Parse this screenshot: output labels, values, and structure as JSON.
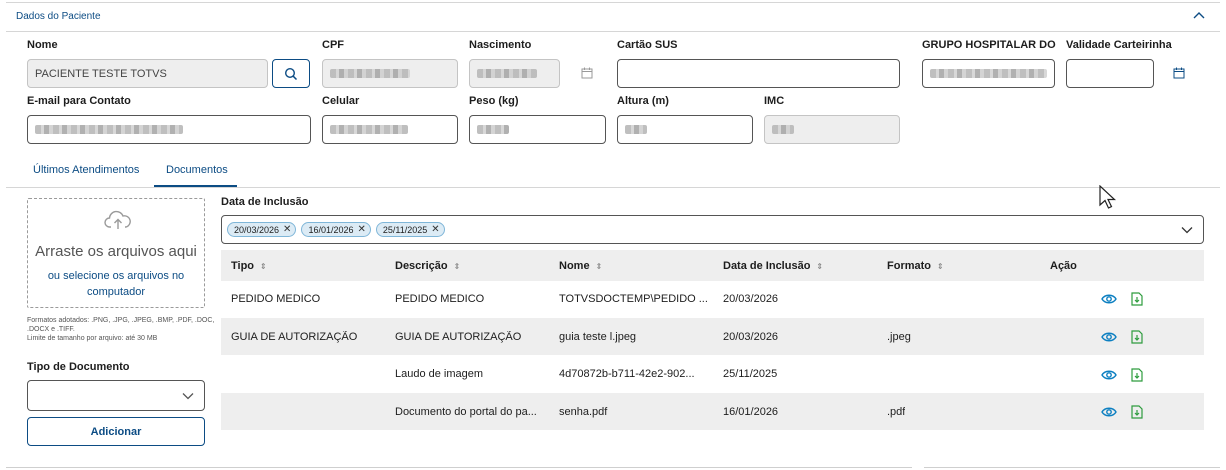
{
  "panel": {
    "title": "Dados do Paciente",
    "collapse_icon": "chevron-up-icon"
  },
  "fields": {
    "nome": {
      "label": "Nome",
      "value": "PACIENTE TESTE TOTVS"
    },
    "cpf": {
      "label": "CPF"
    },
    "nascimento": {
      "label": "Nascimento"
    },
    "cartao_sus": {
      "label": "Cartão SUS",
      "value": ""
    },
    "grupo": {
      "label": "GRUPO HOSPITALAR DO"
    },
    "validade": {
      "label": "Validade Carteirinha",
      "value": ""
    },
    "email": {
      "label": "E-mail para Contato"
    },
    "celular": {
      "label": "Celular"
    },
    "peso": {
      "label": "Peso (kg)"
    },
    "altura": {
      "label": "Altura (m)"
    },
    "imc": {
      "label": "IMC"
    }
  },
  "tabs": [
    {
      "label": "Últimos Atendimentos"
    },
    {
      "label": "Documentos"
    }
  ],
  "upload": {
    "title": "Arraste os arquivos aqui",
    "link": "ou selecione os arquivos no computador",
    "formats": "Formatos adotados: .PNG, .JPG, .JPEG, .BMP, .PDF, .DOC, .DOCX e .TIFF.",
    "limit": "Limite de tamanho por arquivo: até 30 MB"
  },
  "tipo_documento": {
    "label": "Tipo de Documento",
    "value": ""
  },
  "add_button": "Adicionar",
  "filter": {
    "label": "Data de Inclusão",
    "chips": [
      "20/03/2026",
      "16/01/2026",
      "25/11/2025"
    ]
  },
  "table": {
    "headers": [
      "Tipo",
      "Descrição",
      "Nome",
      "Data de Inclusão",
      "Formato",
      "Ação"
    ],
    "rows": [
      {
        "tipo": "PEDIDO MEDICO",
        "descricao": "PEDIDO MEDICO",
        "nome": "TOTVSDOCTEMP\\PEDIDO ...",
        "data": "20/03/2026",
        "formato": ""
      },
      {
        "tipo": "GUIA DE AUTORIZAÇÃO",
        "descricao": "GUIA DE AUTORIZAÇÃO",
        "nome": "guia teste l.jpeg",
        "data": "20/03/2026",
        "formato": ".jpeg"
      },
      {
        "tipo": "",
        "descricao": "Laudo de imagem",
        "nome": "4d70872b-b711-42e2-902...",
        "data": "25/11/2025",
        "formato": ""
      },
      {
        "tipo": "",
        "descricao": "Documento do portal do pa...",
        "nome": "senha.pdf",
        "data": "16/01/2026",
        "formato": ".pdf"
      }
    ]
  },
  "colors": {
    "primary": "#0c4c84",
    "download_green": "#2e9c3e",
    "row_alt": "#eeeeee"
  }
}
